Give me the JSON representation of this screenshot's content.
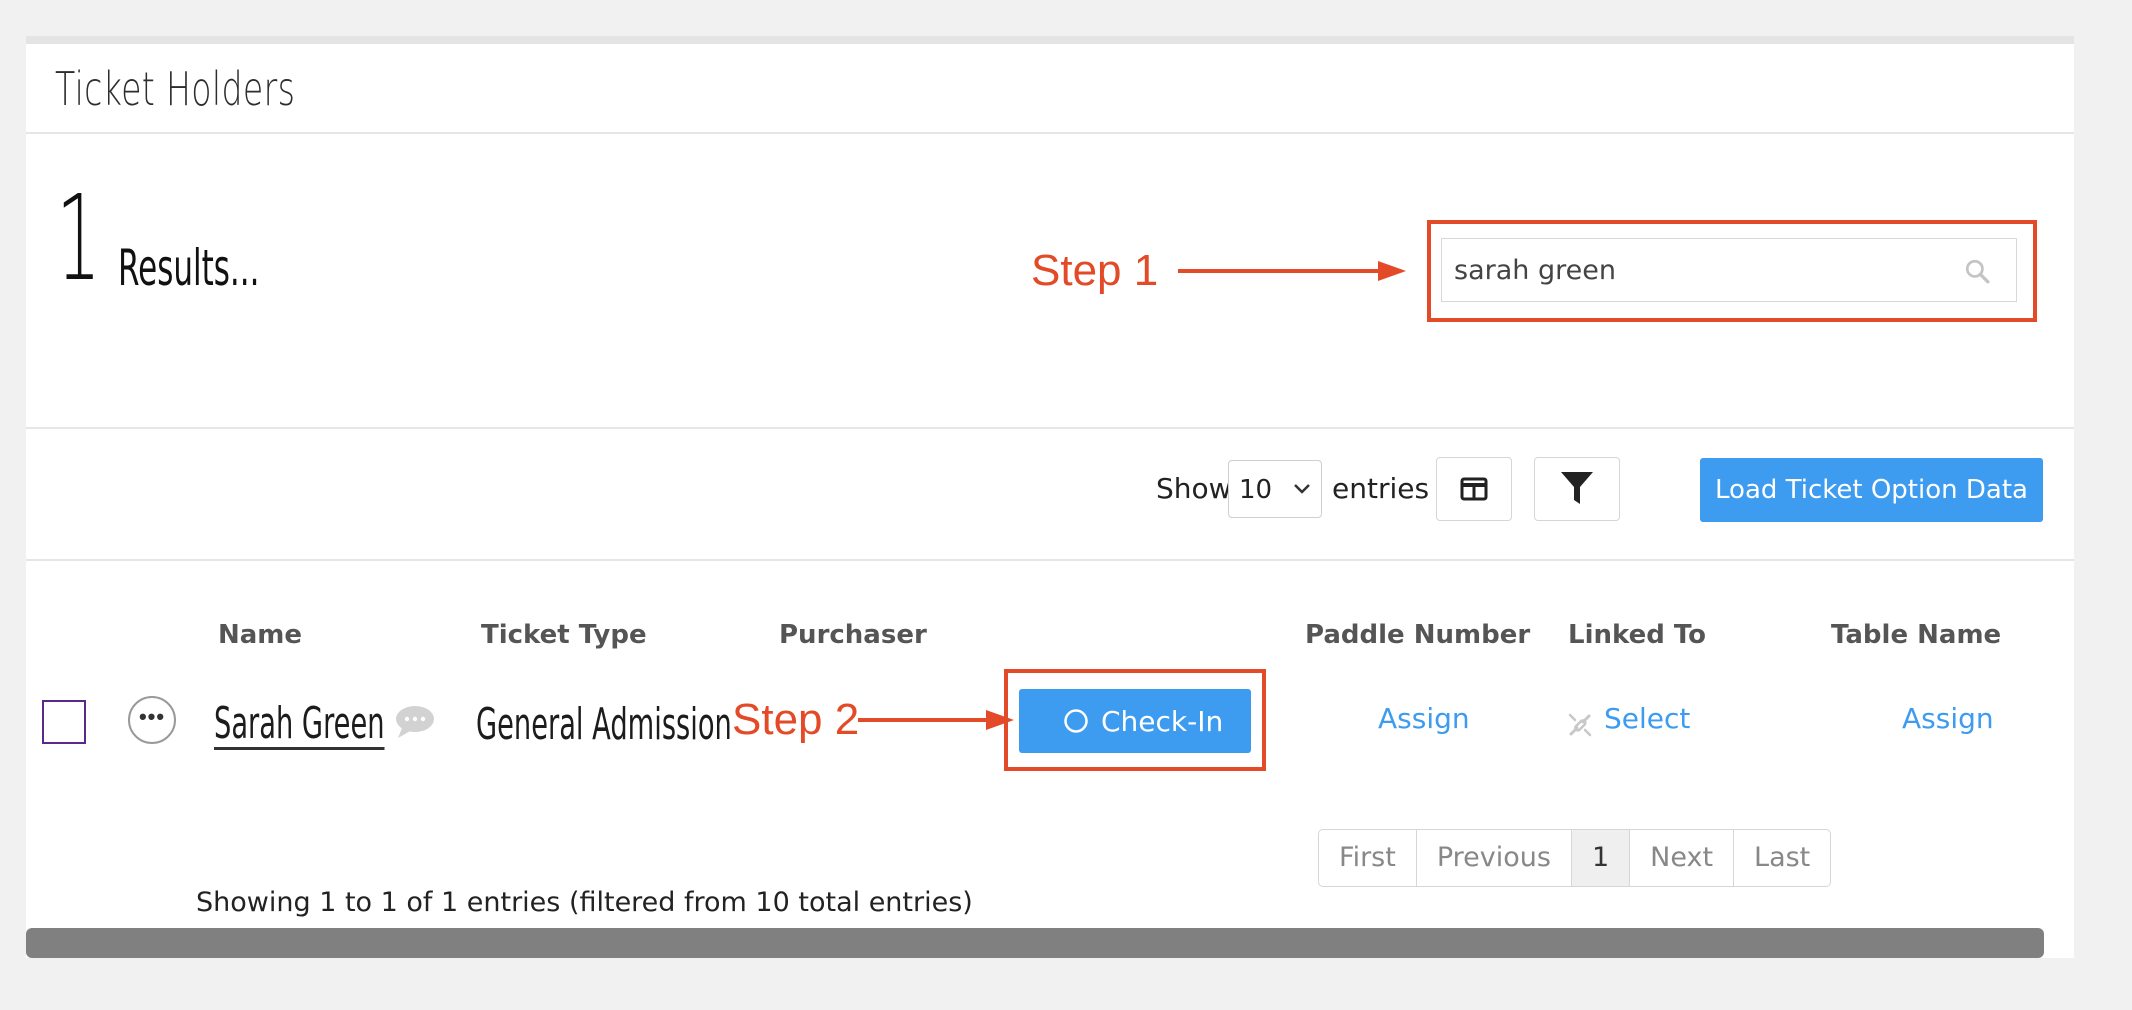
{
  "panel": {
    "title": "Ticket Holders"
  },
  "results": {
    "count": "1",
    "label": "Results..."
  },
  "annotations": {
    "step1": "Step 1",
    "step2": "Step 2",
    "color": "#e34a27"
  },
  "search": {
    "value": "sarah green",
    "icon": "search-icon"
  },
  "toolbar": {
    "show_label": "Show",
    "page_size": "10",
    "entries_label": "entries",
    "columns_icon": "columns-icon",
    "filter_icon": "filter-icon",
    "load_button": "Load Ticket Option Data"
  },
  "table": {
    "headers": {
      "name": "Name",
      "ticket_type": "Ticket Type",
      "purchaser": "Purchaser",
      "paddle_number": "Paddle Number",
      "linked_to": "Linked To",
      "table_name": "Table Name"
    },
    "rows": [
      {
        "name": "Sarah Green",
        "ticket_type": "General Admission",
        "checkin_label": "Check-In",
        "paddle_action": "Assign",
        "linked_action": "Select",
        "table_action": "Assign"
      }
    ]
  },
  "footer": {
    "info": "Showing 1 to 1 of 1 entries (filtered from 10 total entries)"
  },
  "pagination": {
    "first": "First",
    "previous": "Previous",
    "current": "1",
    "next": "Next",
    "last": "Last"
  },
  "colors": {
    "primary": "#3d9bf0",
    "annotation": "#e34a27",
    "scrollbar": "#808080"
  }
}
